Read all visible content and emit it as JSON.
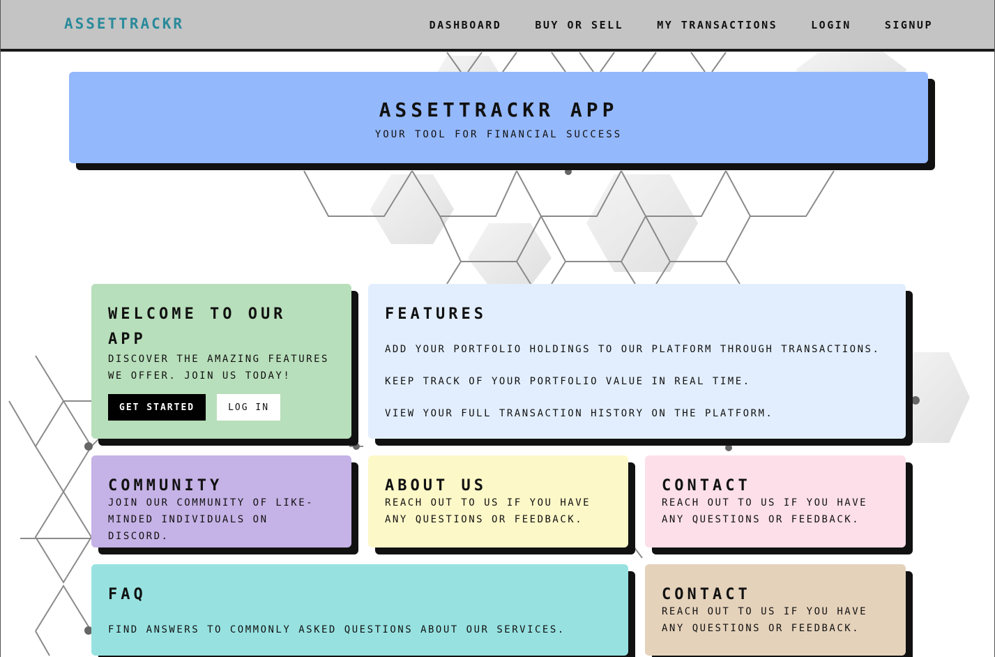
{
  "navbar": {
    "brand": "ASSETTRACKR",
    "links": [
      "DASHBOARD",
      "BUY OR SELL",
      "MY TRANSACTIONS",
      "LOGIN",
      "SIGNUP"
    ]
  },
  "hero": {
    "title": "ASSETTRACKR APP",
    "subtitle": "YOUR TOOL FOR FINANCIAL SUCCESS"
  },
  "welcome": {
    "title": "WELCOME TO OUR APP",
    "text": "DISCOVER THE AMAZING FEATURES WE OFFER. JOIN US TODAY!",
    "primary_button": "GET STARTED",
    "secondary_button": "LOG IN"
  },
  "features": {
    "title": "FEATURES",
    "items": [
      "ADD YOUR PORTFOLIO HOLDINGS TO OUR PLATFORM THROUGH TRANSACTIONS.",
      "KEEP TRACK OF YOUR PORTFOLIO VALUE IN REAL TIME.",
      "VIEW YOUR FULL TRANSACTION HISTORY ON THE PLATFORM."
    ]
  },
  "community": {
    "title": "COMMUNITY",
    "text": "JOIN OUR COMMUNITY OF LIKE-MINDED INDIVIDUALS ON DISCORD."
  },
  "about": {
    "title": "ABOUT US",
    "text": "REACH OUT TO US IF YOU HAVE ANY QUESTIONS OR FEEDBACK."
  },
  "contact": {
    "title": "CONTACT",
    "text": "REACH OUT TO US IF YOU HAVE ANY QUESTIONS OR FEEDBACK."
  },
  "faq": {
    "title": "FAQ",
    "text": "FIND ANSWERS TO COMMONLY ASKED QUESTIONS ABOUT OUR SERVICES."
  },
  "contact2": {
    "title": "CONTACT",
    "text": "REACH OUT TO US IF YOU HAVE ANY QUESTIONS OR FEEDBACK."
  },
  "colors": {
    "navbar_bg": "#c4c4c4",
    "brand": "#2a8a9a",
    "hero_bg": "#94b8fc",
    "welcome_bg": "#b8dfbb",
    "features_bg": "#e2eefd",
    "community_bg": "#c5b2e6",
    "about_bg": "#fdf8c8",
    "contact_bg": "#fcdfe9",
    "faq_bg": "#97e2e1",
    "contact2_bg": "#e5d2bb",
    "shadow": "#111111"
  }
}
